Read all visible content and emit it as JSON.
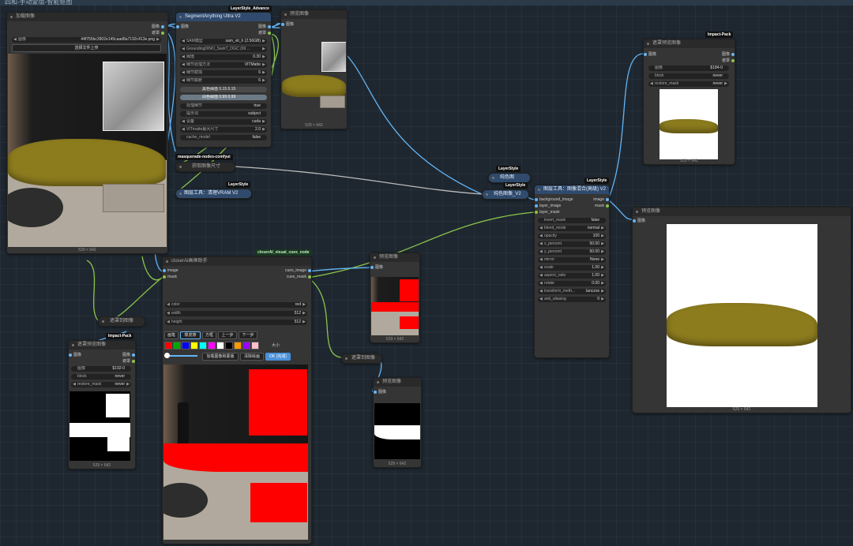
{
  "workflow_title": "四和-手动蒙版-智能抠图",
  "colors": {
    "ports_image": "#64b5f6",
    "ports_mask": "#8bc34a"
  },
  "load_image": {
    "title": "加载图像",
    "out_image": "图像",
    "out_mask": "遮罩",
    "image_label": "图像",
    "image_value": "44f755bc3902e145caad8a7192c413e.png",
    "upload_label": "选择文件上传",
    "size": "529 × 642"
  },
  "segment": {
    "badge": "LayerStyle_Advance",
    "title": "SegmentAnything Ultra V2",
    "in_image": "图像",
    "out_image": "图像",
    "out_mask": "遮罩",
    "widgets": [
      {
        "label": "SAM模型",
        "value": "sam_vit_h (2.56GB)"
      },
      {
        "label": "GroundingDINO_SwinT_OGC (69 ...",
        "value": ""
      },
      {
        "label": "阈值",
        "value": "0.30"
      },
      {
        "label": "细节处理方法",
        "value": "VITMatte"
      },
      {
        "label": "细节腐蚀",
        "value": "6"
      },
      {
        "label": "细节膨胀",
        "value": "6"
      }
    ],
    "black_point": "黑色阈值  0.15  0.15",
    "white_point": "白色阈值  0.99  0.99",
    "widgets2": [
      {
        "label": "处理细节",
        "value": "true"
      },
      {
        "label": "提示词",
        "value": "subject"
      },
      {
        "label": "设备",
        "value": "cuda"
      },
      {
        "label": "VITmatte最大尺寸",
        "value": "2.0"
      },
      {
        "label": "cache_model",
        "value": "false"
      }
    ]
  },
  "preview_top": {
    "title": "预览图像",
    "in_image": "图像",
    "size": "529 × 642"
  },
  "masquerade": {
    "badge": "masquerade-nodes-comfyui",
    "title": "获取图像尺寸"
  },
  "purge_vram": {
    "badge": "LayerStyle",
    "title": "图层工具：清理VRAM V2"
  },
  "solid_color": {
    "badge": "LayerStyle",
    "title": "纯色图"
  },
  "color_image": {
    "badge": "LayerStyle",
    "title": "纯色图像_V2"
  },
  "blend": {
    "badge": "LayerStyle",
    "title": "图层工具：图像混合(高级) V2",
    "inputs": [
      "background_image",
      "layer_image",
      "layer_mask"
    ],
    "outputs": [
      "image",
      "mask"
    ],
    "widgets": [
      {
        "label": "invert_mask",
        "value": "false"
      },
      {
        "label": "blend_mode",
        "value": "normal"
      },
      {
        "label": "opacity",
        "value": "100"
      },
      {
        "label": "x_percent",
        "value": "50.00"
      },
      {
        "label": "y_percent",
        "value": "50.00"
      },
      {
        "label": "mirror",
        "value": "None"
      },
      {
        "label": "scale",
        "value": "1.00"
      },
      {
        "label": "aspect_ratio",
        "value": "1.00"
      },
      {
        "label": "rotate",
        "value": "0.00"
      },
      {
        "label": "transform_meth...",
        "value": "lanczos"
      },
      {
        "label": "anti_aliasing",
        "value": "0"
      }
    ]
  },
  "mask_preview_top": {
    "badge": "Impact-Pack",
    "title": "遮罩预览图像",
    "in_image": "图像",
    "out_image": "图像",
    "out_mask": "遮罩",
    "image_label": "图像",
    "image_value": "$184-0",
    "block_label": "block",
    "block_value": "never",
    "restore_label": "restore_mask",
    "restore_value": "never",
    "size": "529 × 642"
  },
  "preview_big": {
    "title": "预览图像",
    "in_image": "图像",
    "size": "529 × 642"
  },
  "closerai": {
    "badge": "closerAI_visual_cues_node",
    "title": "closerAI画框助手",
    "in_image": "image",
    "in_mask": "mask",
    "out_image": "cues_image",
    "out_mask": "cues_mask",
    "widgets": [
      {
        "label": "color",
        "value": "red"
      },
      {
        "label": "width",
        "value": "512"
      },
      {
        "label": "height",
        "value": "512"
      }
    ],
    "tools": [
      "画笔",
      "橡皮擦",
      "方框",
      "上一步",
      "下一步"
    ],
    "palette": [
      "#ff0000",
      "#00aa00",
      "#0000ff",
      "#ffff00",
      "#00ffff",
      "#ff00ff",
      "#ffffff",
      "#000000",
      "#ff9900",
      "#9900ff",
      "#ffc0cb"
    ],
    "size_label": "大小",
    "load_button": "加载图像和蒙版",
    "clear_button": "清除绘画",
    "ok_button": "OK (完成)"
  },
  "mask_to_image_1": {
    "title": "遮罩到图像"
  },
  "mask_to_image_2": {
    "title": "遮罩到图像"
  },
  "preview_mid": {
    "title": "预览图像",
    "in_image": "图像",
    "size": "529 × 642"
  },
  "preview_mask": {
    "title": "预览图像",
    "in_image": "图像",
    "size": "529 × 642"
  },
  "mask_preview_left": {
    "badge": "Impact-Pack",
    "title": "遮罩预览图像",
    "in_image": "图像",
    "out_image": "图像",
    "out_mask": "遮罩",
    "image_label": "图像",
    "image_value": "$192-0",
    "block_label": "block",
    "block_value": "never",
    "restore_label": "restore_mask",
    "restore_value": "never",
    "size": "529 × 642"
  }
}
